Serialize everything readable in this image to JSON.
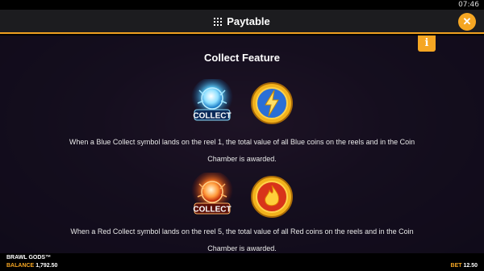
{
  "status_bar": {
    "time": "07:46"
  },
  "header": {
    "title": "Paytable",
    "close_icon": "close-icon",
    "grid_icon": "grid-icon"
  },
  "info_button": {
    "label": "i"
  },
  "section": {
    "title": "Collect Feature",
    "blue": {
      "text": "When a Blue Collect symbol lands on the reel 1, the total value of all Blue coins on the reels and in the Coin Chamber is awarded.",
      "symbol_label": "COLLECT",
      "coin_icon": "lightning-coin-icon"
    },
    "red": {
      "text": "When a Red Collect symbol lands on the reel 5, the total value of all Red coins on the reels and in the Coin Chamber is awarded.",
      "symbol_label": "COLLECT",
      "coin_icon": "fire-coin-icon"
    }
  },
  "footer": {
    "game_name": "BRAWL GODS™",
    "balance_label": "BALANCE",
    "balance_value": "1,792.50",
    "bet_label": "BET",
    "bet_value": "12.50"
  },
  "colors": {
    "accent": "#f5a623",
    "blue_glow": "#4fc3ff",
    "red_glow": "#ff5a1f",
    "coin_gold": "#f2b21c"
  }
}
